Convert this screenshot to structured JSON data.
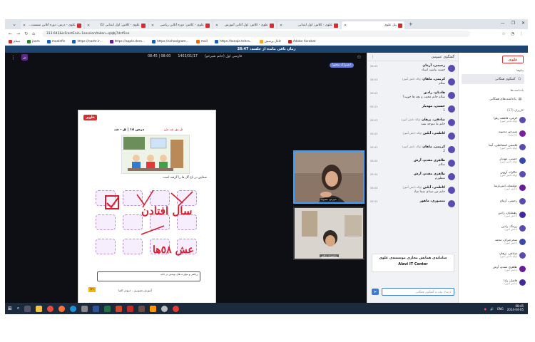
{
  "browser": {
    "tabs": [
      {
        "label": "علوی - درس: دوره آنلاین نشست..."
      },
      {
        "label": "علوی - کلاس: اول ابتدایی (1)"
      },
      {
        "label": "علوی - کلاس: دوره آنلاین ریاضی"
      },
      {
        "label": "علوی - کلاس: اول آنلاین آموزش"
      },
      {
        "label": "علوی - کلاس: اول ابتدایی"
      },
      {
        "label": "پنل علوی"
      }
    ],
    "url": "313.642&isFrontEnd=1session/token=qlqbj7dct5ne",
    "bookmarks": [
      "ثبتنام",
      "jaam",
      "moalefin",
      "https://nashr.ir...",
      "https://apple.dera...",
      "https://schoolgram...",
      "mail",
      "https://tanqie.tehra...",
      "کانال پرسش",
      "Adobe Acrobat"
    ]
  },
  "timer_text": "زمان باقی مانده از جلسه: 26:47",
  "stage": {
    "room_title": "فارسی اول (خانم شیرخو)",
    "date": "1403/01/17",
    "time": "08:00 | 08:45",
    "share_tag": "اشتراک محتوا",
    "doc": {
      "logo": "علوی",
      "title": "درس ۱۸ | ق - شـ",
      "letters": "ق ـق شـ ش",
      "wordline": "شقایق در باغ گل ها را گرفته است",
      "handwriting": [
        "سال افتادن",
        "عش ٥٨ها"
      ],
      "footer": "ریاضی و مهارت های نوشتن در خانه",
      "page_no": "۱۲۱",
      "caption": "آموزش تصویری - حروف الفبا"
    },
    "cam1_label": "شیرخو، محبوبه",
    "cam2_label": "منصوری، ماهور"
  },
  "chat": {
    "title": "گفتگوی عمومی",
    "messages": [
      {
        "name": "رحیمی، آرمان",
        "role": "",
        "text": "خسته نباشید استاد",
        "time": "08:43"
      },
      {
        "name": "کریمی، ماهان",
        "role": "(والد دانش آموز)",
        "text": "سلام",
        "time": "08:43"
      },
      {
        "name": "هادیان، رادین",
        "role": "",
        "text": "سلام خانم محبت و بچه ها خوبید؟",
        "time": "08:43"
      },
      {
        "name": "حسنی، مهدیار",
        "role": "",
        "text": "1",
        "time": "08:43"
      },
      {
        "name": "صادقی، برهان",
        "role": "(والد دانش آموز)",
        "text": "خانم ما متوجه نشد",
        "time": "08:43"
      },
      {
        "name": "کاظمی، آیلین",
        "role": "(والد دانش آموز)",
        "text": "",
        "time": "08:43"
      },
      {
        "name": "کریمی، ماهان",
        "role": "(والد دانش آموز)",
        "text": "2",
        "time": "08:43"
      },
      {
        "name": "طاهری مقدم، آرش",
        "role": "",
        "text": "سلام",
        "time": "08:44"
      },
      {
        "name": "طاهری مقدم، آرش",
        "role": "",
        "text": "منظورم",
        "time": "08:44"
      },
      {
        "name": "کاظمی، آیلین",
        "role": "(والد دانش آموز)",
        "text": "خانم من صدای شما میاد",
        "time": "08:44"
      },
      {
        "name": "منصوری، ماهور",
        "role": "",
        "text": "",
        "time": "08:45"
      }
    ],
    "banner_line1": "سامانه‌ی همایش مجازی موسسه‌ی علوی",
    "banner_line2": "Alavi IT Center",
    "input_placeholder": "ارسال پیام به گفتگوی همگانی"
  },
  "sidebar": {
    "logo": "علوی",
    "section_messages": "پیام‌ها",
    "btn_chat": "گفتگوی همگانی",
    "section_notes": "یادداشت‌ها",
    "btn_notes": "یادداشت‌های همگانی",
    "users_title": "کاربران (17)",
    "participants": [
      {
        "name": "کرمی، فاطمه زهرا",
        "role": "(والد دانش آموز)"
      },
      {
        "name": "شیرخو، محبوبه",
        "role": "(مدرس)"
      },
      {
        "name": "قاسمی اسماعیلی، آنیتا",
        "role": "(والد دانش آموز)"
      },
      {
        "name": "حسنی، مهدیار",
        "role": "(والد دانش آموز)"
      },
      {
        "name": "خاکزاد، آروین",
        "role": "(والد دانش آموز)"
      },
      {
        "name": "دولتشاه، امیرپارسا",
        "role": "(دانش آموز)"
      },
      {
        "name": "رحیمی، آرمان",
        "role": ""
      },
      {
        "name": "رهنمایان، رادین",
        "role": "(دانش آموز)"
      },
      {
        "name": "زرتنگ، رادین",
        "role": "(دانش آموز)"
      },
      {
        "name": "سحرخیزان، محمد",
        "role": "(دانش آموز)"
      },
      {
        "name": "صادقی، برهان",
        "role": "(والد دانش آموز)"
      },
      {
        "name": "طاهری مقدم، آرش",
        "role": "(دانش آموز)"
      },
      {
        "name": "فاضل، رادا",
        "role": "(دانش آموز)"
      }
    ]
  },
  "taskbar": {
    "time": "08:45",
    "date": "2024-04-05",
    "lang": "ENG"
  }
}
